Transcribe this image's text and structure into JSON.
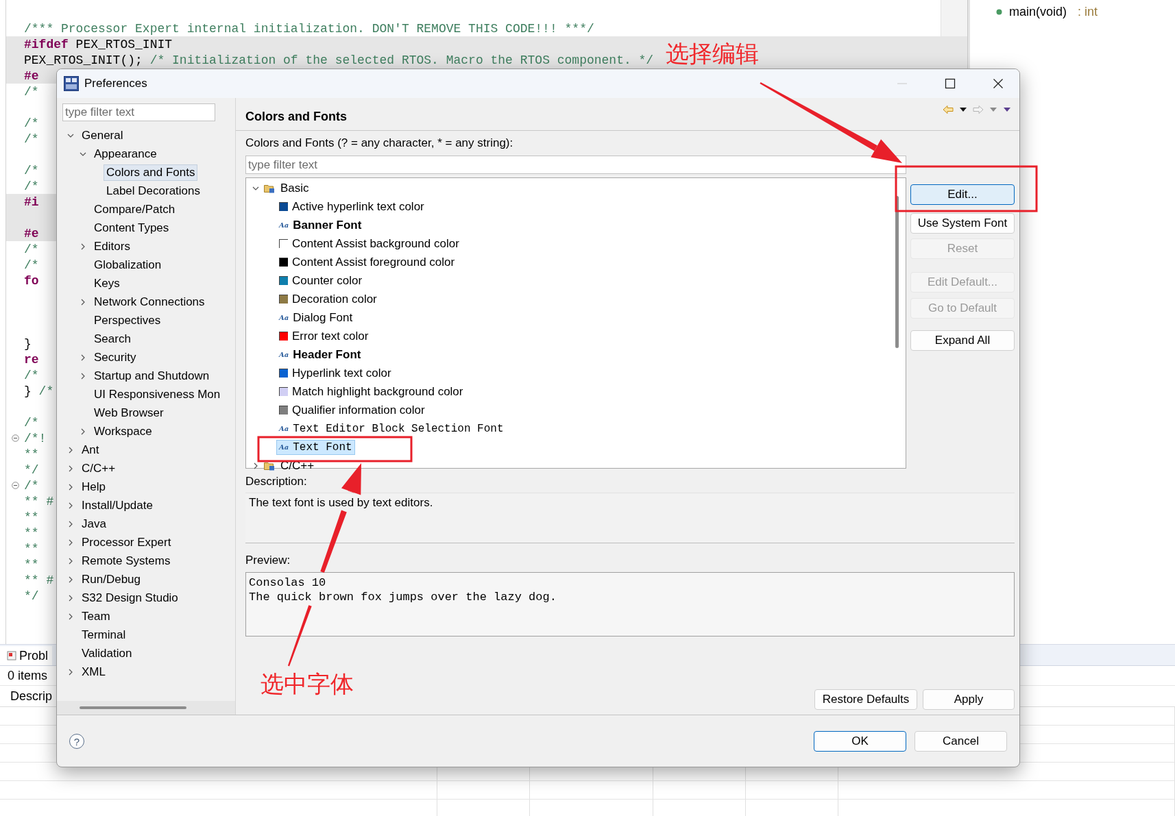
{
  "editor": {
    "lines": [
      {
        "kind": "text",
        "segments": [
          {
            "kind": "comment",
            "text": "/*** Processor Expert internal initialization. DON'T REMOVE THIS CODE!!! ***/"
          }
        ]
      },
      {
        "kind": "text",
        "shaded": true,
        "segments": [
          {
            "kind": "directive",
            "text": "#ifdef"
          },
          {
            "kind": "code",
            "text": "PEX_RTOS_INIT"
          }
        ]
      },
      {
        "kind": "text",
        "shaded": true,
        "segments": [
          {
            "kind": "code",
            "text": "PEX_RTOS_INIT();"
          },
          {
            "kind": "comment",
            "text": "/* Initialization of the selected RTOS. Macro"
          },
          {
            "kind": "comment",
            "text": "the RTOS component. */"
          }
        ]
      },
      {
        "kind": "text",
        "shaded": true,
        "segments": [
          {
            "kind": "directive",
            "text": "#e"
          }
        ]
      },
      {
        "kind": "text",
        "segments": [
          {
            "kind": "comment",
            "text": "/*"
          }
        ]
      },
      {
        "kind": "blank"
      },
      {
        "kind": "text",
        "segments": [
          {
            "kind": "comment",
            "text": "/*"
          }
        ]
      },
      {
        "kind": "text",
        "segments": [
          {
            "kind": "comment",
            "text": "/*"
          }
        ]
      },
      {
        "kind": "blank"
      },
      {
        "kind": "text",
        "segments": [
          {
            "kind": "comment",
            "text": "/*"
          }
        ]
      },
      {
        "kind": "text",
        "segments": [
          {
            "kind": "comment",
            "text": "/*"
          }
        ]
      },
      {
        "kind": "text",
        "shaded": true,
        "segments": [
          {
            "kind": "directive",
            "text": "#i"
          }
        ]
      },
      {
        "kind": "blank",
        "shaded": true
      },
      {
        "kind": "text",
        "shaded": true,
        "segments": [
          {
            "kind": "directive",
            "text": "#e"
          }
        ]
      },
      {
        "kind": "text",
        "segments": [
          {
            "kind": "comment",
            "text": "/*"
          }
        ]
      },
      {
        "kind": "text",
        "segments": [
          {
            "kind": "comment",
            "text": "/*"
          }
        ]
      },
      {
        "kind": "text",
        "segments": [
          {
            "kind": "directive",
            "text": "fo"
          }
        ]
      },
      {
        "kind": "blank"
      },
      {
        "kind": "blank"
      },
      {
        "kind": "blank"
      },
      {
        "kind": "text",
        "segments": [
          {
            "kind": "code",
            "text": "}"
          }
        ]
      },
      {
        "kind": "text",
        "segments": [
          {
            "kind": "directive",
            "text": "re"
          }
        ]
      },
      {
        "kind": "text",
        "segments": [
          {
            "kind": "comment",
            "text": "/*"
          }
        ]
      },
      {
        "kind": "text",
        "segments": [
          {
            "kind": "code",
            "text": "}"
          },
          {
            "kind": "comment",
            "text": "/*"
          }
        ]
      },
      {
        "kind": "blank"
      },
      {
        "kind": "text",
        "segments": [
          {
            "kind": "comment",
            "text": "/*"
          }
        ]
      },
      {
        "kind": "text",
        "fold": true,
        "segments": [
          {
            "kind": "comment",
            "text": "/*!"
          }
        ]
      },
      {
        "kind": "text",
        "segments": [
          {
            "kind": "comment",
            "text": "**"
          }
        ]
      },
      {
        "kind": "text",
        "segments": [
          {
            "kind": "comment",
            "text": "*/"
          }
        ]
      },
      {
        "kind": "text",
        "fold": true,
        "segments": [
          {
            "kind": "comment",
            "text": "/*"
          }
        ]
      },
      {
        "kind": "text",
        "segments": [
          {
            "kind": "comment",
            "text": "** #"
          }
        ]
      },
      {
        "kind": "text",
        "segments": [
          {
            "kind": "comment",
            "text": "**"
          }
        ]
      },
      {
        "kind": "text",
        "segments": [
          {
            "kind": "comment",
            "text": "**"
          }
        ]
      },
      {
        "kind": "text",
        "segments": [
          {
            "kind": "comment",
            "text": "**"
          }
        ]
      },
      {
        "kind": "text",
        "segments": [
          {
            "kind": "comment",
            "text": "**"
          }
        ]
      },
      {
        "kind": "text",
        "segments": [
          {
            "kind": "comment",
            "text": "** #"
          }
        ]
      },
      {
        "kind": "text",
        "segments": [
          {
            "kind": "comment",
            "text": "*/"
          }
        ]
      }
    ]
  },
  "outline": {
    "items": [
      {
        "label": "main(void)",
        "type": ": int"
      }
    ]
  },
  "problems": {
    "tab": "Probl",
    "count": "0 items",
    "columns": [
      "Descrip"
    ]
  },
  "dialog": {
    "title": "Preferences",
    "filter_placeholder": "type filter text",
    "tree": [
      {
        "label": "General",
        "kind": "group",
        "expanded": true,
        "selected": false,
        "children": [
          {
            "label": "Appearance",
            "kind": "group",
            "expanded": true,
            "selected": false,
            "children": [
              {
                "label": "Colors and Fonts",
                "kind": "page",
                "selected": true
              },
              {
                "label": "Label Decorations",
                "kind": "page",
                "selected": false
              }
            ]
          },
          {
            "label": "Compare/Patch",
            "kind": "page",
            "selected": false
          },
          {
            "label": "Content Types",
            "kind": "page",
            "selected": false
          },
          {
            "label": "Editors",
            "kind": "group",
            "expanded": false,
            "selected": false
          },
          {
            "label": "Globalization",
            "kind": "page",
            "selected": false
          },
          {
            "label": "Keys",
            "kind": "page",
            "selected": false
          },
          {
            "label": "Network Connections",
            "kind": "group",
            "expanded": false,
            "selected": false
          },
          {
            "label": "Perspectives",
            "kind": "page",
            "selected": false
          },
          {
            "label": "Search",
            "kind": "page",
            "selected": false
          },
          {
            "label": "Security",
            "kind": "group",
            "expanded": false,
            "selected": false
          },
          {
            "label": "Startup and Shutdown",
            "kind": "group",
            "expanded": false,
            "selected": false
          },
          {
            "label": "UI Responsiveness Mon",
            "kind": "page",
            "selected": false
          },
          {
            "label": "Web Browser",
            "kind": "page",
            "selected": false
          },
          {
            "label": "Workspace",
            "kind": "group",
            "expanded": false,
            "selected": false
          }
        ]
      },
      {
        "label": "Ant",
        "kind": "group",
        "expanded": false,
        "selected": false
      },
      {
        "label": "C/C++",
        "kind": "group",
        "expanded": false,
        "selected": false
      },
      {
        "label": "Help",
        "kind": "group",
        "expanded": false,
        "selected": false
      },
      {
        "label": "Install/Update",
        "kind": "group",
        "expanded": false,
        "selected": false
      },
      {
        "label": "Java",
        "kind": "group",
        "expanded": false,
        "selected": false
      },
      {
        "label": "Processor Expert",
        "kind": "group",
        "expanded": false,
        "selected": false
      },
      {
        "label": "Remote Systems",
        "kind": "group",
        "expanded": false,
        "selected": false
      },
      {
        "label": "Run/Debug",
        "kind": "group",
        "expanded": false,
        "selected": false
      },
      {
        "label": "S32 Design Studio",
        "kind": "group",
        "expanded": false,
        "selected": false
      },
      {
        "label": "Team",
        "kind": "group",
        "expanded": false,
        "selected": false
      },
      {
        "label": "Terminal",
        "kind": "page",
        "selected": false
      },
      {
        "label": "Validation",
        "kind": "page",
        "selected": false
      },
      {
        "label": "XML",
        "kind": "group",
        "expanded": false,
        "selected": false
      }
    ],
    "page": {
      "title": "Colors and Fonts",
      "filter_label": "Colors and Fonts (? = any character, * = any string):",
      "filter_placeholder": "type filter text",
      "items": [
        {
          "label": "Basic",
          "kind": "category",
          "expanded": true,
          "selected": false,
          "children": [
            {
              "label": "Active hyperlink text color",
              "kind": "color",
              "color": "#0b4a94",
              "selected": false
            },
            {
              "label": "Banner Font",
              "kind": "boldfont",
              "icon": "Aa",
              "selected": false
            },
            {
              "label": "Content Assist background color",
              "kind": "color",
              "color": "#ffffff",
              "selected": false
            },
            {
              "label": "Content Assist foreground color",
              "kind": "color",
              "color": "#000000",
              "selected": false
            },
            {
              "label": "Counter color",
              "kind": "color",
              "color": "#0f7fad",
              "selected": false
            },
            {
              "label": "Decoration color",
              "kind": "color",
              "color": "#8e7a45",
              "selected": false
            },
            {
              "label": "Dialog Font",
              "kind": "font",
              "icon": "Aa",
              "selected": false
            },
            {
              "label": "Error text color",
              "kind": "color",
              "color": "#ff0000",
              "selected": false
            },
            {
              "label": "Header Font",
              "kind": "boldfont",
              "icon": "Aa",
              "selected": false
            },
            {
              "label": "Hyperlink text color",
              "kind": "color",
              "color": "#0a62d1",
              "selected": false
            },
            {
              "label": "Match highlight background color",
              "kind": "color",
              "color": "#d1cff4",
              "selected": false
            },
            {
              "label": "Qualifier information color",
              "kind": "color",
              "color": "#7f7f7f",
              "selected": false
            },
            {
              "label": "Text Editor Block Selection Font",
              "kind": "monofont",
              "icon": "Aa",
              "selected": false
            },
            {
              "label": "Text Font",
              "kind": "monofont",
              "icon": "Aa",
              "selected": true
            }
          ]
        },
        {
          "label": "C/C++",
          "kind": "category",
          "expanded": false,
          "selected": false
        }
      ],
      "buttons": [
        {
          "label": "Edit...",
          "disabled": false,
          "focused": true
        },
        {
          "label": "Use System Font",
          "disabled": false,
          "focused": false
        },
        {
          "label": "Reset",
          "disabled": true,
          "focused": false
        },
        {
          "label": "Edit Default...",
          "disabled": true,
          "focused": false
        },
        {
          "label": "Go to Default",
          "disabled": true,
          "focused": false
        },
        {
          "label": "Expand All",
          "disabled": false,
          "focused": false
        }
      ],
      "description_label": "Description:",
      "description": "The text font is used by text editors.",
      "preview_label": "Preview:",
      "preview": [
        "Consolas 10",
        "The quick brown fox jumps over the lazy dog."
      ],
      "page_buttons": [
        {
          "label": "Restore Defaults"
        },
        {
          "label": "Apply"
        }
      ]
    },
    "help": "?",
    "buttons": [
      {
        "label": "OK",
        "default": true
      },
      {
        "label": "Cancel",
        "default": false
      }
    ]
  },
  "annotations": [
    {
      "text": "选择编辑"
    },
    {
      "text": "选中字体"
    }
  ]
}
